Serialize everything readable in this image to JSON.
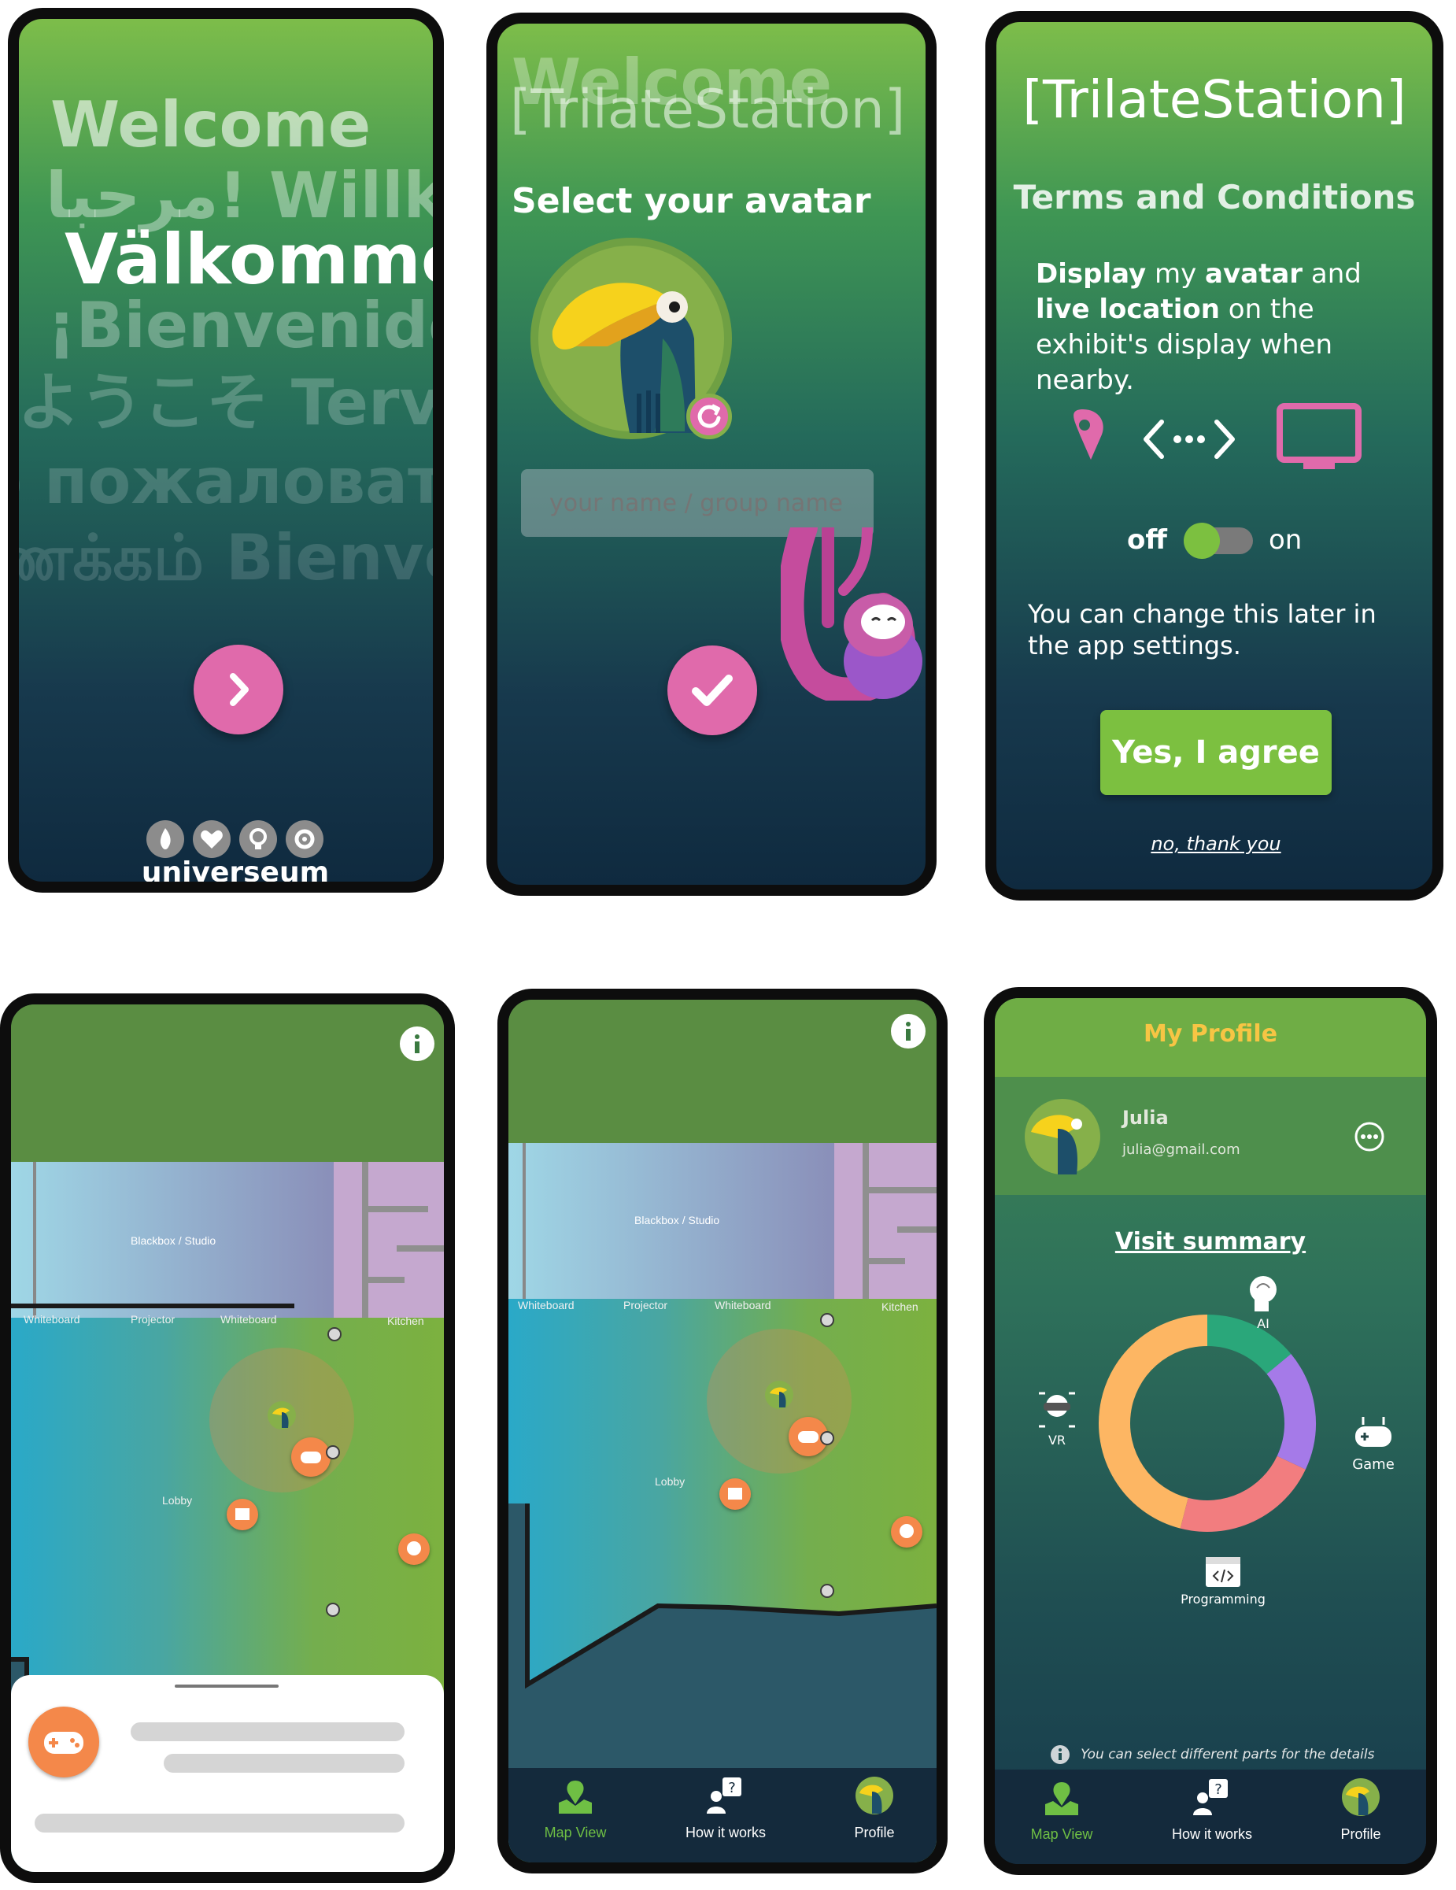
{
  "welcome": {
    "greetings": [
      "Welcome",
      "مرحبا! Willkommen",
      "Välkommen",
      "¡Bienvenido!",
      "ようこそ Tervetuloa",
      "Добро пожаловать नमस्ते",
      "வணக்கம் Bienvenue"
    ],
    "next_icon": "chevron-right-icon",
    "brand": "universeum",
    "brand_icons": [
      "flame-icon",
      "heart-icon",
      "bulb-icon",
      "ring-icon"
    ]
  },
  "avatar": {
    "bg_title": "Welcome",
    "app_name": "[TrilateStation]",
    "heading": "Select your avatar",
    "name_placeholder": "your name / group name",
    "avatar_icon": "toucan-icon",
    "refresh_icon": "refresh-icon",
    "confirm_icon": "checkmark-icon"
  },
  "terms": {
    "app_name": "[TrilateStation]",
    "title": "Terms and Conditions",
    "desc": {
      "b1": "Display",
      "t1": " my ",
      "b2": "avatar",
      "t2": " and ",
      "b3": "live location",
      "t3": " on the exhibit's display when nearby."
    },
    "toggle_off": "off",
    "toggle_on": "on",
    "toggle_state": "off",
    "note": "You can change this later in the app settings.",
    "agree": "Yes, I agree",
    "decline": "no, thank you"
  },
  "map": {
    "rooms": {
      "blackbox": "Blackbox / Studio",
      "whiteboard": "Whiteboard",
      "projector": "Projector",
      "kitchen": "Kitchen",
      "lobby": "Lobby"
    },
    "info_icon": "info-icon"
  },
  "nav": {
    "items": [
      {
        "label": "Map View",
        "icon": "map-pin-icon",
        "active": true
      },
      {
        "label": "How it works",
        "icon": "help-person-icon",
        "active": false
      },
      {
        "label": "Profile",
        "icon": "toucan-avatar-icon",
        "active": false
      }
    ],
    "active_color": "#6fbf44"
  },
  "profile": {
    "header": "My Profile",
    "name": "Julia",
    "email": "julia@gmail.com",
    "summary_title": "Visit summary",
    "segments": [
      {
        "label": "AI",
        "value": 14,
        "color": "#2aa77a"
      },
      {
        "label": "Game",
        "value": 18,
        "color": "#a57ae8"
      },
      {
        "label": "Programming",
        "value": 22,
        "color": "#f27d7f"
      },
      {
        "label": "VR",
        "value": 46,
        "color": "#fdb663"
      }
    ],
    "hint": "You can select different parts for the details"
  },
  "colors": {
    "accent_pink": "#e06aab",
    "accent_green": "#7cc040",
    "poi_orange": "#f4884a",
    "header_yellow": "#f7c544"
  }
}
